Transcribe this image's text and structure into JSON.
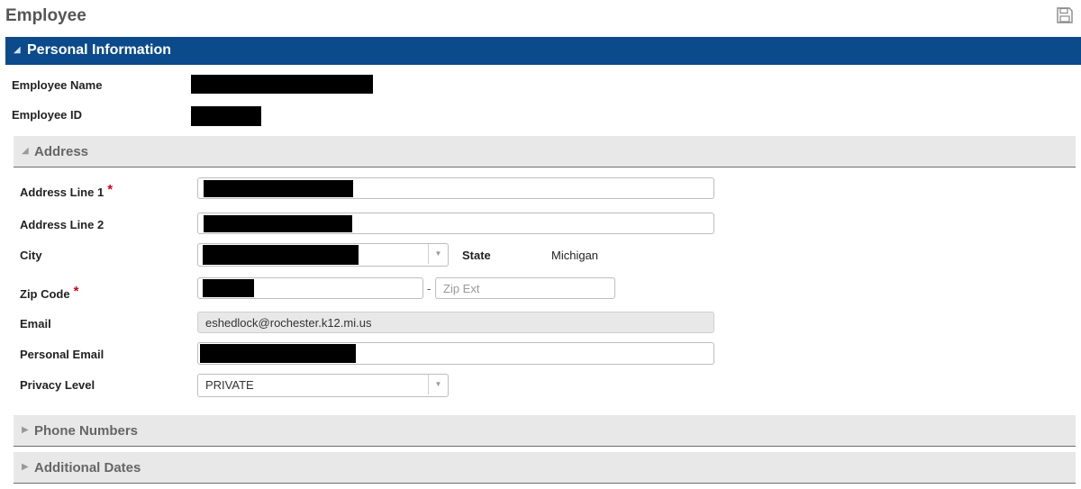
{
  "page": {
    "title": "Employee"
  },
  "personal": {
    "title": "Personal Information",
    "employee_name_label": "Employee Name",
    "employee_id_label": "Employee ID"
  },
  "address": {
    "title": "Address",
    "line1_label": "Address Line 1",
    "line2_label": "Address Line 2",
    "city_label": "City",
    "state_label": "State",
    "state_value": "Michigan",
    "zip_label": "Zip Code",
    "zip_ext_placeholder": "Zip Ext",
    "email_label": "Email",
    "email_value": "eshedlock@rochester.k12.mi.us",
    "personal_email_label": "Personal Email",
    "privacy_label": "Privacy Level",
    "privacy_value": "PRIVATE",
    "required_mark": "*"
  },
  "sections": {
    "phone_numbers": "Phone Numbers",
    "additional_dates": "Additional Dates"
  },
  "icons": {
    "save": "save-icon",
    "expanded": "triangle-down-icon",
    "collapsed": "triangle-right-icon",
    "dropdown": "chevron-down-icon"
  },
  "colors": {
    "panel_header": "#0b4a8b",
    "section_bar": "#e8e8e8",
    "required": "#d0021b"
  }
}
